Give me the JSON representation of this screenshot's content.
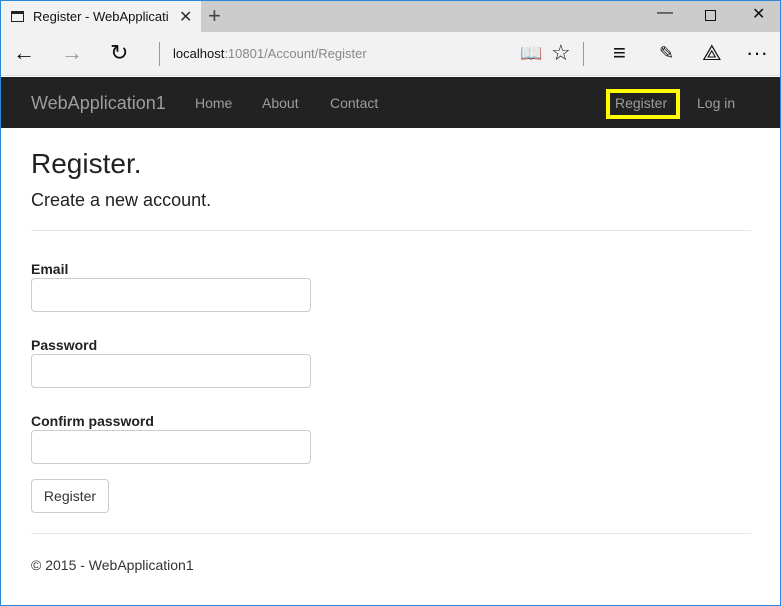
{
  "browser": {
    "tab_title": "Register - WebApplication1",
    "url_host": "localhost",
    "url_path": ":10801/Account/Register"
  },
  "navbar": {
    "brand": "WebApplication1",
    "links": [
      "Home",
      "About",
      "Contact"
    ],
    "right": [
      "Register",
      "Log in"
    ],
    "highlight_color": "#ffff00"
  },
  "page": {
    "title": "Register.",
    "subtitle": "Create a new account.",
    "fields": [
      {
        "label": "Email",
        "value": ""
      },
      {
        "label": "Password",
        "value": ""
      },
      {
        "label": "Confirm password",
        "value": ""
      }
    ],
    "submit": "Register"
  },
  "footer": "© 2015 - WebApplication1"
}
